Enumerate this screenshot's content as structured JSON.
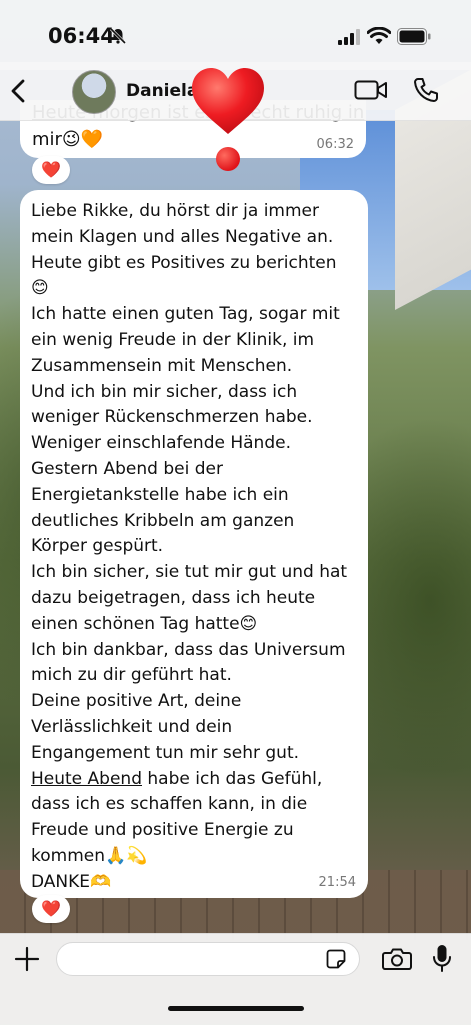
{
  "status_bar": {
    "time": "06:44"
  },
  "header": {
    "back_label": "<",
    "contact_name": "Daniela"
  },
  "messages": [
    {
      "partial_text": "Heute morgen ist es ... recht ruhig in",
      "text_line2": "mir😉🧡",
      "time": "06:32",
      "reaction": "❤️"
    },
    {
      "before_link": "Liebe Rikke, du hörst dir ja immer\nmein Klagen und alles Negative an.\nHeute gibt es Positives zu berichten\n😊\nIch hatte einen guten Tag, sogar mit\nein wenig Freude in der Klinik, im\nZusammensein mit Menschen.\nUnd ich bin mir sicher, dass ich\nweniger Rückenschmerzen habe.\nWeniger einschlafende Hände.\nGestern Abend bei der\nEnergietankstelle habe ich ein\ndeutliches Kribbeln am ganzen\nKörper gespürt.\nIch bin sicher, sie tut mir gut und hat\ndazu beigetragen,  dass ich heute\neinen schönen Tag hatte😊\nIch bin dankbar, dass das Universum\nmich zu dir geführt hat.\nDeine positive Art, deine\nVerlässlichkeit und dein\nEngangement tun mir sehr gut.\n",
      "link": "Heute Abend",
      "after_link": " habe ich das Gefühl,\ndass ich es schaffen kann, in die\nFreude und positive Energie zu\nkommen🙏💫\nDANKE🫶",
      "time": "21:54",
      "reaction": "❤️"
    }
  ],
  "big_reaction": "❤️",
  "composer": {
    "placeholder": ""
  },
  "colors": {
    "heart": "#e0141a",
    "bubble": "#ffffff",
    "bar": "#f6f6f6"
  },
  "icons": [
    "mute-bell-icon",
    "signal-icon",
    "wifi-icon",
    "battery-icon",
    "back-chevron-icon",
    "video-call-icon",
    "phone-call-icon",
    "plus-icon",
    "sticker-icon",
    "camera-icon",
    "microphone-icon"
  ]
}
